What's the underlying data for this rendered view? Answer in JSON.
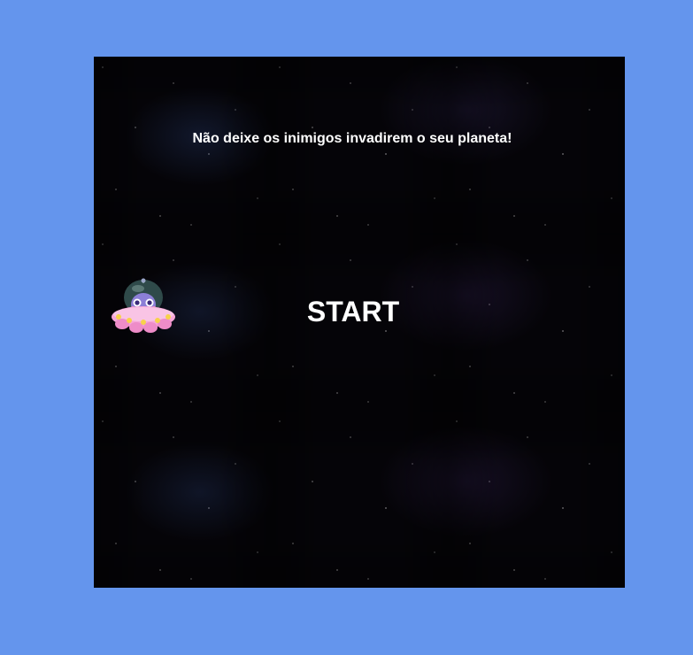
{
  "game": {
    "tagline": "Não deixe os inimigos invadirem o seu planeta!",
    "start_label": "START",
    "player_icon": "alien-ufo-icon"
  },
  "colors": {
    "page_background": "#6495ED",
    "game_background": "#050408",
    "text": "#FFFFFF",
    "ufo_body": "#F6A6D8",
    "ufo_dome": "#2F4A4A",
    "ufo_lights": "#F7D24A",
    "alien": "#8C7FD6"
  }
}
